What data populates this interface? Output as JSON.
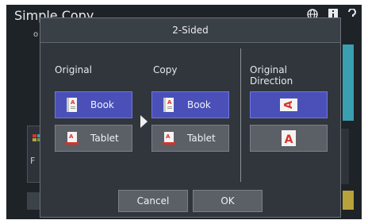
{
  "background": {
    "title": "Simple Copy",
    "subtext": "o",
    "card_text": "F"
  },
  "dialog": {
    "title": "2-Sided",
    "original": {
      "label": "Original",
      "options": [
        {
          "label": "Book",
          "icon": "book-icon",
          "selected": true
        },
        {
          "label": "Tablet",
          "icon": "tablet-icon",
          "selected": false
        }
      ]
    },
    "copy": {
      "label": "Copy",
      "options": [
        {
          "label": "Book",
          "icon": "book-icon",
          "selected": true
        },
        {
          "label": "Tablet",
          "icon": "tablet-icon",
          "selected": false
        }
      ]
    },
    "direction": {
      "label_line1": "Original",
      "label_line2": "Direction",
      "options": [
        {
          "glyph": "A",
          "orientation": "rotated",
          "selected": true
        },
        {
          "glyph": "A",
          "orientation": "upright",
          "selected": false
        }
      ]
    },
    "buttons": {
      "cancel": "Cancel",
      "ok": "OK"
    }
  },
  "colors": {
    "selected": "#4a50b8",
    "unselected": "#5a6066",
    "accent_red": "#d8332b"
  }
}
